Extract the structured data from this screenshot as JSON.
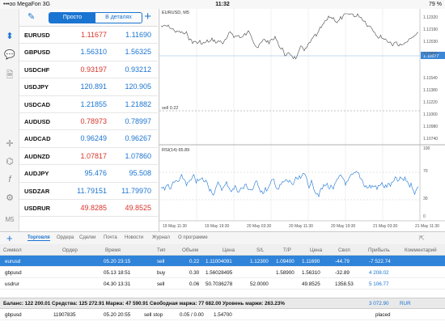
{
  "status": {
    "carrier": "•••oo MegaFon",
    "network": "3G",
    "time": "11:32",
    "battery": "79 %"
  },
  "toolbar": {
    "tab_simple": "Просто",
    "tab_details": "В деталях"
  },
  "sidebar": {
    "icons": [
      "bars-icon",
      "chat-icon",
      "document-icon",
      "crosshair-icon",
      "objects-icon",
      "function-icon",
      "settings-icon",
      "timeframe-icon"
    ],
    "timeframe": "M5"
  },
  "quotes": [
    {
      "symbol": "EURUSD",
      "bid": "1.11677",
      "ask": "1.11690",
      "bid_color": "dn",
      "ask_color": "up"
    },
    {
      "symbol": "GBPUSD",
      "bid": "1.56310",
      "ask": "1.56325",
      "bid_color": "up",
      "ask_color": "up"
    },
    {
      "symbol": "USDCHF",
      "bid": "0.93197",
      "ask": "0.93212",
      "bid_color": "dn",
      "ask_color": "up"
    },
    {
      "symbol": "USDJPY",
      "bid": "120.891",
      "ask": "120.905",
      "bid_color": "up",
      "ask_color": "up"
    },
    {
      "symbol": "USDCAD",
      "bid": "1.21855",
      "ask": "1.21882",
      "bid_color": "up",
      "ask_color": "up"
    },
    {
      "symbol": "AUDUSD",
      "bid": "0.78973",
      "ask": "0.78997",
      "bid_color": "dn",
      "ask_color": "up"
    },
    {
      "symbol": "AUDCAD",
      "bid": "0.96249",
      "ask": "0.96267",
      "bid_color": "up",
      "ask_color": "up"
    },
    {
      "symbol": "AUDNZD",
      "bid": "1.07817",
      "ask": "1.07860",
      "bid_color": "dn",
      "ask_color": "up"
    },
    {
      "symbol": "AUDJPY",
      "bid": "95.476",
      "ask": "95.508",
      "bid_color": "up",
      "ask_color": "up"
    },
    {
      "symbol": "USDZAR",
      "bid": "11.79151",
      "ask": "11.79970",
      "bid_color": "up",
      "ask_color": "up"
    },
    {
      "symbol": "USDRUR",
      "bid": "49.8285",
      "ask": "49.8525",
      "bid_color": "dn",
      "ask_color": "dn"
    }
  ],
  "chart": {
    "title": "EURUSD, M5",
    "price_axis": [
      "1.12320",
      "1.12190",
      "1.12030",
      "1.11870",
      "1.11677",
      "1.11540",
      "1.11380",
      "1.11220",
      "1.11060",
      "1.10980",
      "1.10740"
    ],
    "current_price": "1.11677",
    "sell_line_label": "sell 0.22",
    "rsi_label": "RSI(14) 65.89",
    "rsi_axis": [
      "100",
      "70",
      "30",
      "0"
    ],
    "time_axis": [
      "19 May 11:30",
      "19 May 19:30",
      "20 May 03:30",
      "20 May 11:30",
      "20 May 19:30",
      "21 May 03:30",
      "21 May 11:30"
    ]
  },
  "bottom_tabs": [
    "Торговля",
    "Ордера",
    "Сделки",
    "Почта",
    "Новости",
    "Журнал",
    "О программе"
  ],
  "trade_columns": [
    "Символ",
    "Ордер",
    "Время",
    "Тип",
    "Объем",
    "Цена",
    "S/L",
    "T/P",
    "Цена",
    "Своп",
    "Прибыль",
    "Комментарий"
  ],
  "trades": [
    {
      "symbol": "eurusd",
      "order": "",
      "time": "05.20 23:15",
      "type": "sell",
      "volume": "0.22",
      "price": "1.11004091",
      "sl": "1.12300",
      "tp": "1.09400",
      "cur": "1.11690",
      "swap": "-44.79",
      "profit": "-7 522.74",
      "comment": ""
    },
    {
      "symbol": "gbpusd",
      "order": "",
      "time": "05.13 18:51",
      "type": "buy",
      "volume": "0.30",
      "price": "1.56028495",
      "sl": "",
      "tp": "1.58900",
      "cur": "1.56310",
      "swap": "-32.89",
      "profit": "4 208.02",
      "comment": ""
    },
    {
      "symbol": "usdrur",
      "order": "",
      "time": "04.30 13:31",
      "type": "sell",
      "volume": "0.06",
      "price": "50.7036278",
      "sl": "52.0000",
      "tp": "",
      "cur": "49.8525",
      "swap": "1358.53",
      "profit": "5 106.77",
      "comment": ""
    }
  ],
  "balance": {
    "text": "Баланс: 122 200.01 Средства: 125 272.91 Маржа: 47 590.91 Свободная маржа: 77 682.00 Уровень маржи: 263.23%",
    "profit": "3 072.90",
    "currency": "RUR"
  },
  "pending": {
    "symbol": "gbpusd",
    "order": "11907835",
    "time": "05.20 20:55",
    "type": "sell stop",
    "volume": "0.05 / 0.00",
    "price": "1.54700",
    "comment": "placed"
  }
}
